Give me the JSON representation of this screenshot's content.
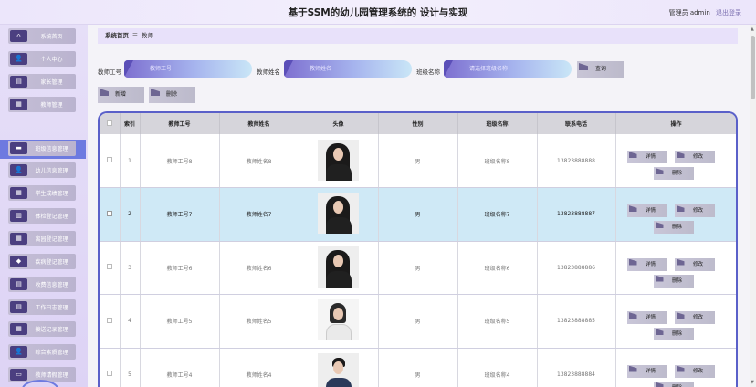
{
  "header": {
    "title": "基于SSM的幼儿园管理系统的 设计与实现",
    "user_text": "管理员 admin",
    "logout": "退出登录"
  },
  "sidebar": {
    "items": [
      {
        "label": "系统首页",
        "icon": "home-icon",
        "glyph": "⌂"
      },
      {
        "label": "个人中心",
        "icon": "user-icon",
        "glyph": "👤"
      },
      {
        "label": "家长管理",
        "icon": "doc-icon",
        "glyph": "▤"
      },
      {
        "label": "教师管理",
        "icon": "grid-icon",
        "glyph": "▦"
      },
      {
        "label": "教师",
        "icon": "",
        "glyph": ""
      },
      {
        "label": "班级信息管理",
        "icon": "chat-icon",
        "glyph": "▬"
      },
      {
        "label": "幼儿信息管理",
        "icon": "user-icon",
        "glyph": "👤"
      },
      {
        "label": "学生成绩管理",
        "icon": "grid-icon",
        "glyph": "▦"
      },
      {
        "label": "体检登记管理",
        "icon": "chart-icon",
        "glyph": "▥"
      },
      {
        "label": "离园登记管理",
        "icon": "grid-icon",
        "glyph": "▦"
      },
      {
        "label": "疾病登记管理",
        "icon": "tag-icon",
        "glyph": "◆"
      },
      {
        "label": "收费信息管理",
        "icon": "list-icon",
        "glyph": "▤"
      },
      {
        "label": "工作日志管理",
        "icon": "doc-icon",
        "glyph": "▤"
      },
      {
        "label": "接送记录管理",
        "icon": "grid-icon",
        "glyph": "▦"
      },
      {
        "label": "综合素质管理",
        "icon": "person-icon",
        "glyph": "👤"
      },
      {
        "label": "教师请假管理",
        "icon": "folder-icon",
        "glyph": "▭"
      }
    ],
    "active": "教师"
  },
  "breadcrumb": {
    "home": "系统首页",
    "sep": "☰",
    "current": "教师"
  },
  "search": {
    "label1": "教师工号",
    "placeholder1": "教师工号",
    "label2": "教师姓名",
    "placeholder2": "教师姓名",
    "label3": "班级名称",
    "placeholder3": "请选择班级名称",
    "query": "查询"
  },
  "actions": {
    "add": "新增",
    "delete": "删除"
  },
  "table": {
    "headers": [
      "",
      "索引",
      "教师工号",
      "教师姓名",
      "头像",
      "性别",
      "班级名称",
      "联系电话",
      "操作"
    ],
    "rows": [
      {
        "index": "1",
        "no": "教师工号8",
        "name": "教师姓名8",
        "gender": "男",
        "class": "班级名称8",
        "phone": "13823888888",
        "avatar": "woman-black"
      },
      {
        "index": "2",
        "no": "教师工号7",
        "name": "教师姓名7",
        "gender": "男",
        "class": "班级名称7",
        "phone": "13823888887",
        "avatar": "woman-black"
      },
      {
        "index": "3",
        "no": "教师工号6",
        "name": "教师姓名6",
        "gender": "男",
        "class": "班级名称6",
        "phone": "13823888886",
        "avatar": "woman-black"
      },
      {
        "index": "4",
        "no": "教师工号5",
        "name": "教师姓名5",
        "gender": "男",
        "class": "班级名称5",
        "phone": "13823888885",
        "avatar": "woman-white"
      },
      {
        "index": "5",
        "no": "教师工号4",
        "name": "教师姓名4",
        "gender": "男",
        "class": "班级名称4",
        "phone": "13823888884",
        "avatar": "man-suit"
      }
    ],
    "ops": {
      "detail": "详情",
      "edit": "修改",
      "delete": "删除"
    }
  },
  "colors": {
    "accent": "#6d7ae0",
    "header_bg": "#ece6fb",
    "sidebar_bg": "#e6dff8",
    "selected_row": "#cfe9f6",
    "table_border": "#5a60c9"
  }
}
